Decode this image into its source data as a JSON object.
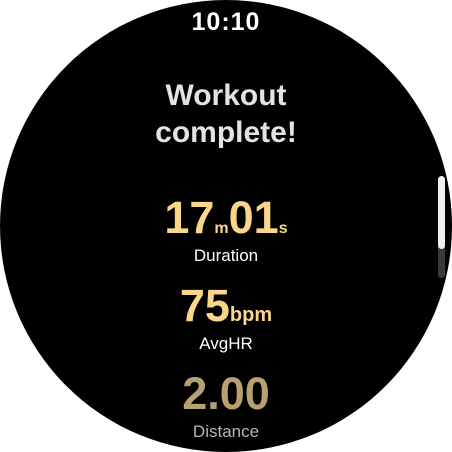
{
  "status": {
    "time": "10:10"
  },
  "heading": {
    "line1": "Workout",
    "line2": "complete!"
  },
  "stats": {
    "duration": {
      "minutes": "17",
      "minutes_unit": "m",
      "seconds": "01",
      "seconds_unit": "s",
      "label": "Duration"
    },
    "avg_hr": {
      "value": "75",
      "unit": "bpm",
      "label": "AvgHR"
    },
    "distance": {
      "value": "2.00",
      "label": "Distance"
    }
  },
  "scroll": {
    "position_fraction": 0.0,
    "visible_fraction": 0.72
  },
  "colors": {
    "value_accent": "#fad68a",
    "value_accent_dim": "#b7a071",
    "background": "#000000",
    "text": "#ffffff"
  }
}
